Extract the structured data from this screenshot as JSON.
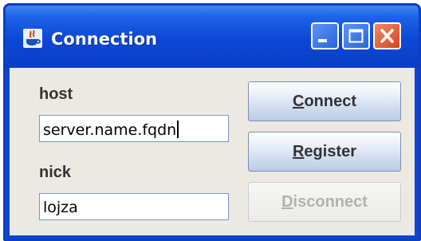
{
  "window": {
    "title": "Connection",
    "app_icon": "java-cup-icon"
  },
  "title_buttons": {
    "minimize": "minimize-icon",
    "maximize": "maximize-icon",
    "close": "close-icon"
  },
  "form": {
    "host_label": "host",
    "host_value": "server.name.fqdn",
    "nick_label": "nick",
    "nick_value": "lojza"
  },
  "buttons": {
    "connect": {
      "mnemonic": "C",
      "rest": "onnect",
      "enabled": true
    },
    "register": {
      "mnemonic": "R",
      "rest": "egister",
      "enabled": true
    },
    "disconnect": {
      "mnemonic": "D",
      "rest": "isconnect",
      "enabled": false
    }
  },
  "colors": {
    "titlebar": "#0b47d6",
    "panel": "#ebe9e1",
    "close_button": "#d8431e",
    "disabled_text": "#b1b1b1"
  }
}
